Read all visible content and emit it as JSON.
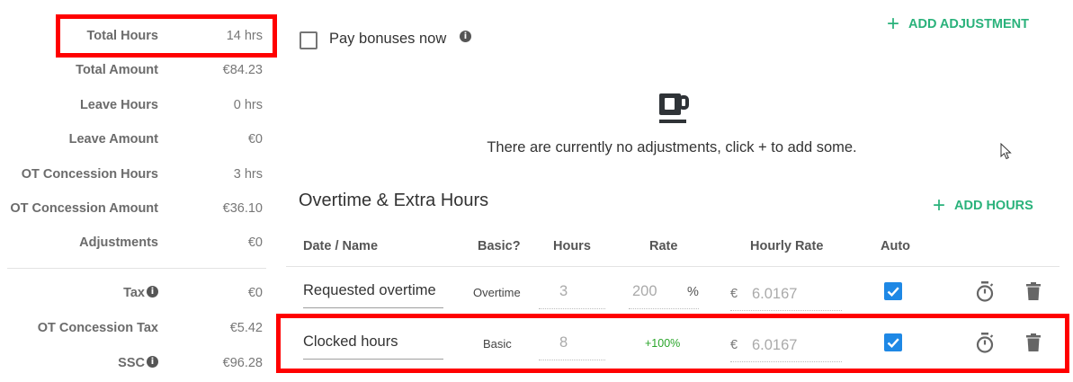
{
  "summary": {
    "rows": [
      {
        "label": "Total Hours",
        "value": "14 hrs",
        "info": false
      },
      {
        "label": "Total Amount",
        "value": "€84.23",
        "info": false
      },
      {
        "label": "Leave Hours",
        "value": "0 hrs",
        "info": false
      },
      {
        "label": "Leave Amount",
        "value": "€0",
        "info": false
      },
      {
        "label": "OT Concession Hours",
        "value": "3 hrs",
        "info": false
      },
      {
        "label": "OT Concession Amount",
        "value": "€36.10",
        "info": false
      },
      {
        "label": "Adjustments",
        "value": "€0",
        "info": false
      },
      {
        "label": "Tax",
        "value": "€0",
        "info": true
      },
      {
        "label": "OT Concession Tax",
        "value": "€5.42",
        "info": false
      },
      {
        "label": "SSC",
        "value": "€96.28",
        "info": true
      }
    ]
  },
  "bonus": {
    "label": "Pay bonuses now",
    "checked": false
  },
  "adjustments": {
    "add_label": "ADD ADJUSTMENT",
    "empty_text": "There are currently no adjustments, click + to add some.",
    "empty_icon": "coffee-cup-icon"
  },
  "overtime": {
    "title": "Overtime & Extra Hours",
    "add_label": "ADD HOURS",
    "columns": [
      "Date / Name",
      "Basic?",
      "Hours",
      "Rate",
      "Hourly Rate",
      "Auto"
    ],
    "rows": [
      {
        "name": "Requested overtime",
        "basic": "Overtime",
        "hours": "3",
        "rate": "200",
        "rate_unit": "%",
        "currency": "€",
        "hourly_rate": "6.0167",
        "auto": true
      },
      {
        "name": "Clocked hours",
        "basic": "Basic",
        "hours": "8",
        "rate": "+100%",
        "rate_unit": "",
        "currency": "€",
        "hourly_rate": "6.0167",
        "auto": true
      }
    ]
  },
  "colors": {
    "accent": "#2ab27b",
    "checkbox": "#1e88e5",
    "highlight": "#ff0000",
    "rate_green": "#2aa52a"
  },
  "info_glyph": "i",
  "plus_glyph": "+"
}
